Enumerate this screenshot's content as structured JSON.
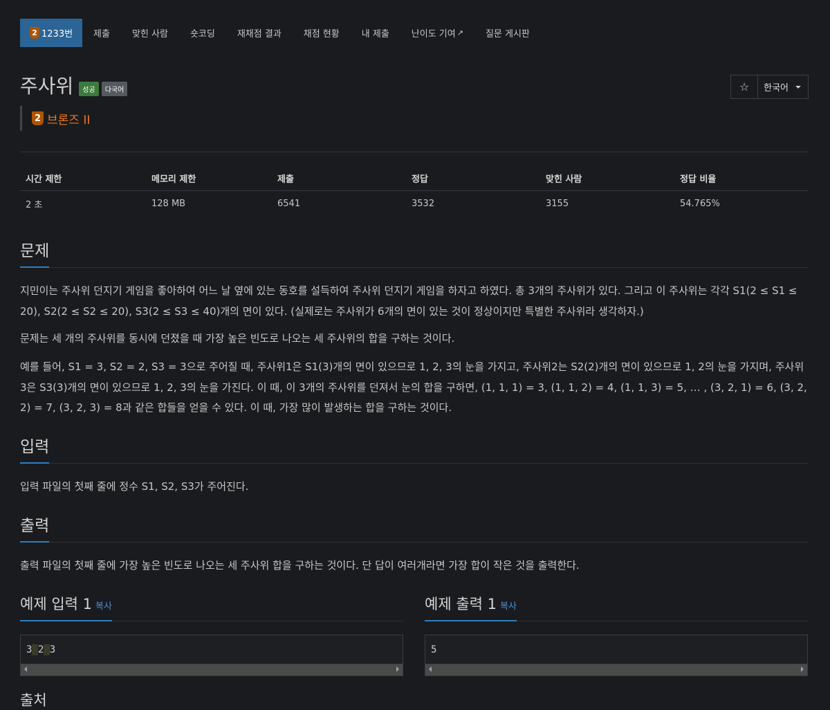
{
  "nav": {
    "problem_number": "1233번",
    "tier_num": "2",
    "items": [
      "제출",
      "맞힌 사람",
      "숏코딩",
      "재채점 결과",
      "채점 현황",
      "내 제출",
      "난이도 기여",
      "질문 게시판"
    ]
  },
  "title": "주사위",
  "badges": {
    "success": "성공",
    "multilang": "다국어"
  },
  "tier": {
    "num": "2",
    "name": "브론즈 II",
    "color": "#e8792c"
  },
  "actions": {
    "star_icon": "star-icon",
    "star": "☆",
    "language": "한국어"
  },
  "stats": {
    "headers": [
      "시간 제한",
      "메모리 제한",
      "제출",
      "정답",
      "맞힌 사람",
      "정답 비율"
    ],
    "values": [
      "2 초",
      "128 MB",
      "6541",
      "3532",
      "3155",
      "54.765%"
    ]
  },
  "sections": {
    "problem": {
      "heading": "문제",
      "paragraphs": [
        "지민이는 주사위 던지기 게임을 좋아하여 어느 날 옆에 있는 동호를 설득하여 주사위 던지기 게임을 하자고 하였다. 총 3개의 주사위가 있다. 그리고 이 주사위는 각각 S1(2 ≤ S1 ≤ 20), S2(2 ≤ S2 ≤ 20), S3(2 ≤ S3 ≤ 40)개의 면이 있다. (실제로는 주사위가 6개의 면이 있는 것이 정상이지만 특별한 주사위라 생각하자.)",
        "문제는 세 개의 주사위를 동시에 던졌을 때 가장 높은 빈도로 나오는 세 주사위의 합을 구하는 것이다.",
        "예를 들어, S1 = 3, S2 = 2, S3 = 3으로 주어질 때, 주사위1은 S1(3)개의 면이 있으므로 1, 2, 3의 눈을 가지고, 주사위2는 S2(2)개의 면이 있으므로 1, 2의 눈을 가지며, 주사위3은 S3(3)개의 면이 있으므로 1, 2, 3의 눈을 가진다. 이 때, 이 3개의 주사위를 던져서 눈의 합을 구하면, (1, 1, 1) = 3, (1, 1, 2) = 4, (1, 1, 3) = 5, … , (3, 2, 1) = 6, (3, 2, 2) = 7, (3, 2, 3) = 8과 같은 합들을 얻을 수 있다. 이 때, 가장 많이 발생하는 합을 구하는 것이다."
      ]
    },
    "input": {
      "heading": "입력",
      "text": "입력 파일의 첫째 줄에 정수 S1, S2, S3가 주어진다."
    },
    "output": {
      "heading": "출력",
      "text": "출력 파일의 첫째 줄에 가장 높은 빈도로 나오는 세 주사위 합을 구하는 것이다. 단 답이 여러개라면 가장 합이 작은 것을 출력한다."
    }
  },
  "samples": {
    "input": {
      "title": "예제 입력 1",
      "copy": "복사",
      "tokens": [
        "3",
        "2",
        "3"
      ]
    },
    "output": {
      "title": "예제 출력 1",
      "copy": "복사",
      "value": "5"
    }
  },
  "next_heading": "출처"
}
